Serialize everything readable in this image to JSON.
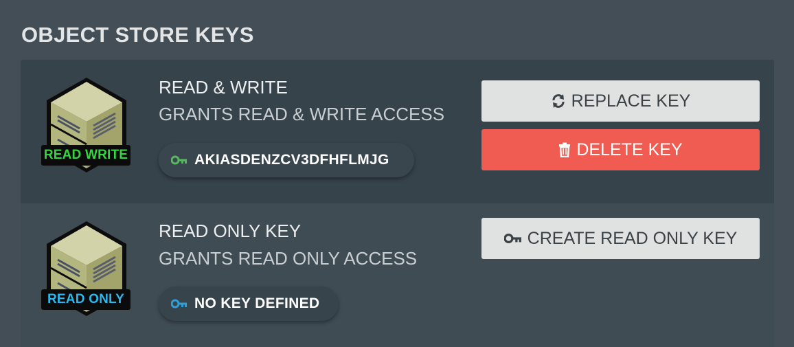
{
  "page": {
    "title": "OBJECT STORE KEYS"
  },
  "keys": [
    {
      "name": "READ & WRITE",
      "description": "GRANTS READ & WRITE ACCESS",
      "badge": "READ WRITE",
      "badge_color": "#33d641",
      "key_value": "AKIASDENZCV3DFHFLMJG",
      "key_icon_color": "#58b85d",
      "key_icon": "key-icon",
      "buttons": [
        {
          "label": "REPLACE KEY",
          "icon": "refresh-icon"
        },
        {
          "label": "DELETE KEY",
          "icon": "trash-icon"
        }
      ]
    },
    {
      "name": "READ ONLY KEY",
      "description": "GRANTS READ ONLY ACCESS",
      "badge": "READ ONLY",
      "badge_color": "#2bb8ee",
      "key_value": "NO KEY DEFINED",
      "key_icon_color": "#2f9fd6",
      "key_icon": "key-icon",
      "buttons": [
        {
          "label": "CREATE READ ONLY KEY",
          "icon": "key-icon"
        }
      ]
    }
  ],
  "colors": {
    "background": "#434e56",
    "panel_dark": "#36434b",
    "delete_red": "#f05b52",
    "button_light": "#e0e1e1"
  }
}
